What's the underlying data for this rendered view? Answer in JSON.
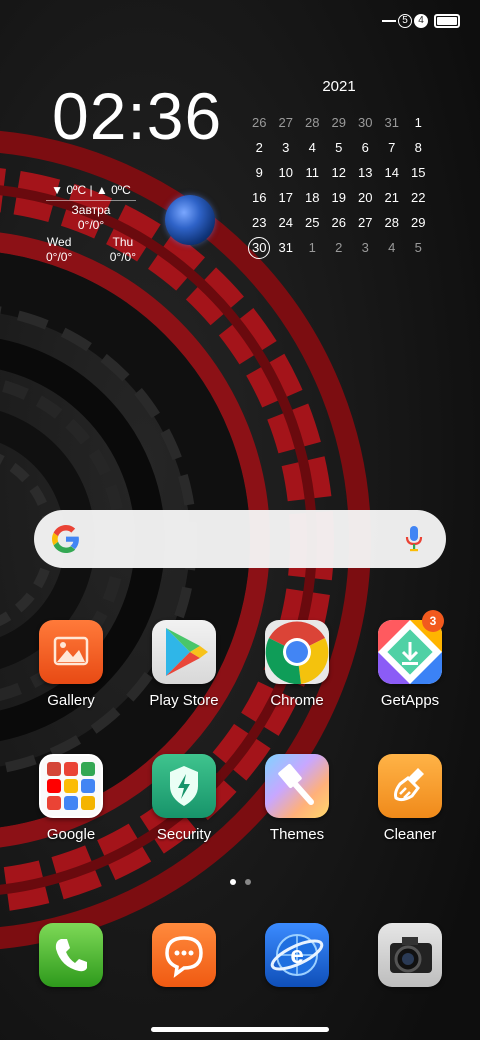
{
  "status_bar": {
    "sim1": "5",
    "sim2": "4",
    "battery_icon": "battery-full-icon"
  },
  "clock": {
    "time": "02:36"
  },
  "weather": {
    "today": "▼ 0ºC | ▲ 0ºC",
    "tomorrow_label": "Завтра",
    "tomorrow_temp": "0°/0°",
    "days": [
      {
        "name": "Wed",
        "temp": "0°/0°"
      },
      {
        "name": "Thu",
        "temp": "0°/0°"
      }
    ]
  },
  "calendar": {
    "year": "2021",
    "weeks": [
      [
        "26",
        "27",
        "28",
        "29",
        "30",
        "31",
        "1"
      ],
      [
        "2",
        "3",
        "4",
        "5",
        "6",
        "7",
        "8"
      ],
      [
        "9",
        "10",
        "11",
        "12",
        "13",
        "14",
        "15"
      ],
      [
        "16",
        "17",
        "18",
        "19",
        "20",
        "21",
        "22"
      ],
      [
        "23",
        "24",
        "25",
        "26",
        "27",
        "28",
        "29"
      ],
      [
        "30",
        "31",
        "1",
        "2",
        "3",
        "4",
        "5"
      ]
    ],
    "today": "30"
  },
  "search_bar": {
    "logo_icon": "google-g-icon",
    "mic_icon": "microphone-icon"
  },
  "apps": [
    {
      "label": "Gallery",
      "icon": "gallery-icon"
    },
    {
      "label": "Play Store",
      "icon": "play-store-icon"
    },
    {
      "label": "Chrome",
      "icon": "chrome-icon"
    },
    {
      "label": "GetApps",
      "icon": "getapps-icon",
      "badge": "3"
    },
    {
      "label": "Google",
      "icon": "google-folder-icon"
    },
    {
      "label": "Security",
      "icon": "security-icon"
    },
    {
      "label": "Themes",
      "icon": "themes-icon"
    },
    {
      "label": "Cleaner",
      "icon": "cleaner-icon"
    }
  ],
  "page_indicator": {
    "pages": 2,
    "current": 1
  },
  "dock": [
    {
      "icon": "phone-icon"
    },
    {
      "icon": "messages-icon"
    },
    {
      "icon": "browser-icon"
    },
    {
      "icon": "camera-icon"
    }
  ],
  "colors": {
    "accent_red": "#b3141a",
    "badge": "#f25a1e",
    "background": "#1b1b1b"
  }
}
